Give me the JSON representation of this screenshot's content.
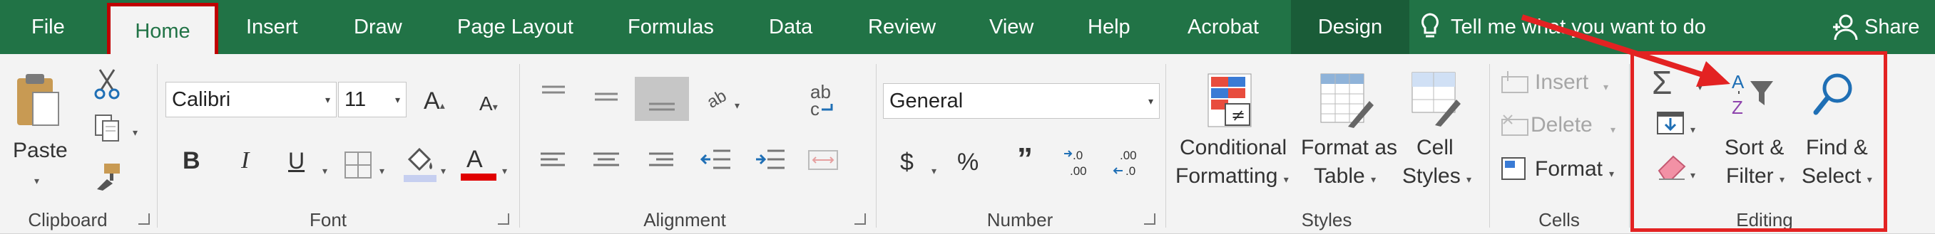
{
  "menu": {
    "file": "File",
    "home": "Home",
    "insert": "Insert",
    "draw": "Draw",
    "page_layout": "Page Layout",
    "formulas": "Formulas",
    "data": "Data",
    "review": "Review",
    "view": "View",
    "help": "Help",
    "acrobat": "Acrobat",
    "design": "Design",
    "tell_me": "Tell me what you want to do",
    "share": "Share"
  },
  "clipboard": {
    "paste": "Paste",
    "label": "Clipboard"
  },
  "font": {
    "name": "Calibri",
    "size": "11",
    "bold": "B",
    "italic": "I",
    "underline": "U",
    "font_color_glyph": "A",
    "label": "Font"
  },
  "alignment": {
    "label": "Alignment"
  },
  "number": {
    "format": "General",
    "currency": "$",
    "percent": "%",
    "comma": "”",
    "inc_decimal": ".00",
    "dec_decimal": ".00",
    "label": "Number"
  },
  "styles": {
    "conditional_1": "Conditional",
    "conditional_2": "Formatting",
    "format_table_1": "Format as",
    "format_table_2": "Table",
    "cell_styles_1": "Cell",
    "cell_styles_2": "Styles",
    "label": "Styles"
  },
  "cells": {
    "insert": "Insert",
    "delete": "Delete",
    "format": "Format",
    "label": "Cells"
  },
  "editing": {
    "sort_1": "Sort &",
    "sort_2": "Filter",
    "find_1": "Find &",
    "find_2": "Select",
    "label": "Editing"
  },
  "colors": {
    "accent": "#217346",
    "highlight": "#c00000",
    "arrow": "#e32222"
  }
}
